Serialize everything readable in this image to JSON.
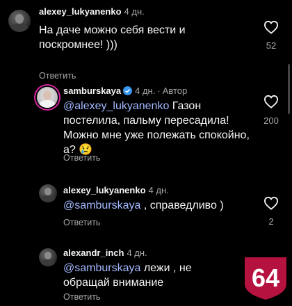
{
  "comments": [
    {
      "username": "alexey_lukyanenko",
      "time": "4 дн.",
      "text": "На даче можно себя вести и поскромнее! )))",
      "reply": "Ответить",
      "likes": "52"
    },
    {
      "username": "samburskaya",
      "time": "4 дн.",
      "separator": "·",
      "author_label": "Автор",
      "mention": "@alexey_lukyanenko",
      "text": " Газон постелила, пальму пересадила! Можно мне уже полежать спокойно, а? 😢",
      "reply": "Ответить",
      "likes": "200"
    },
    {
      "username": "alexey_lukyanenko",
      "time": "4 дн.",
      "mention": "@samburskaya",
      "text": " , справедливо )",
      "reply": "Ответить",
      "likes": "2"
    },
    {
      "username": "alexandr_inch",
      "time": "4 дн.",
      "mention": "@samburskaya",
      "text": " лежи , не обращай внимание",
      "reply": "Ответить"
    }
  ],
  "badge": {
    "label": "64",
    "color": "#b5123f"
  },
  "colors": {
    "mention": "#a3b8ff",
    "verified": "#3897f0",
    "muted": "#a8a8a8"
  }
}
